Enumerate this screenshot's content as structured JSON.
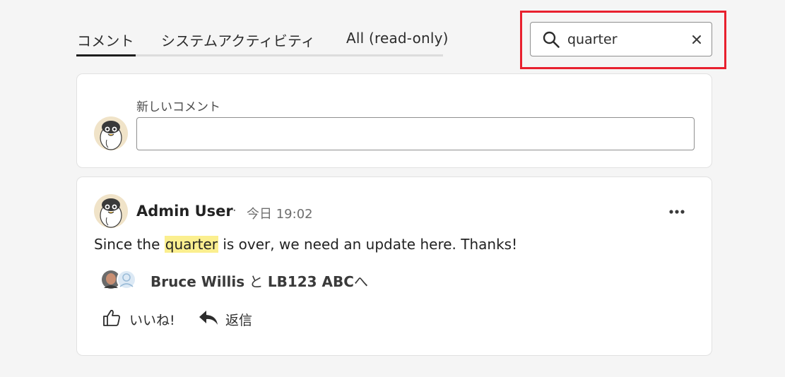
{
  "tabs": [
    {
      "label": "コメント",
      "active": true
    },
    {
      "label": "システムアクティビティ",
      "active": false
    },
    {
      "label": "All (read-only)",
      "active": false
    }
  ],
  "search": {
    "value": "quarter",
    "icon": "search-icon",
    "clear_icon": "close-icon"
  },
  "new_comment": {
    "label": "新しいコメント",
    "value": ""
  },
  "comment": {
    "author": "Admin User",
    "separator": "·",
    "time": "今日 19:02",
    "text_before": "Since the ",
    "text_highlight": "quarter",
    "text_after": " is over, we need an update here. Thanks!",
    "mention_name_1": "Bruce Willis",
    "mention_conj": " と ",
    "mention_name_2": "LB123 ABC",
    "mention_suffix": "へ",
    "like_label": "いいね!",
    "reply_label": "返信"
  },
  "colors": {
    "search_focus_outline": "#e8202e",
    "highlight": "#fbef8f",
    "tab_indicator": "#1e1e1e"
  }
}
